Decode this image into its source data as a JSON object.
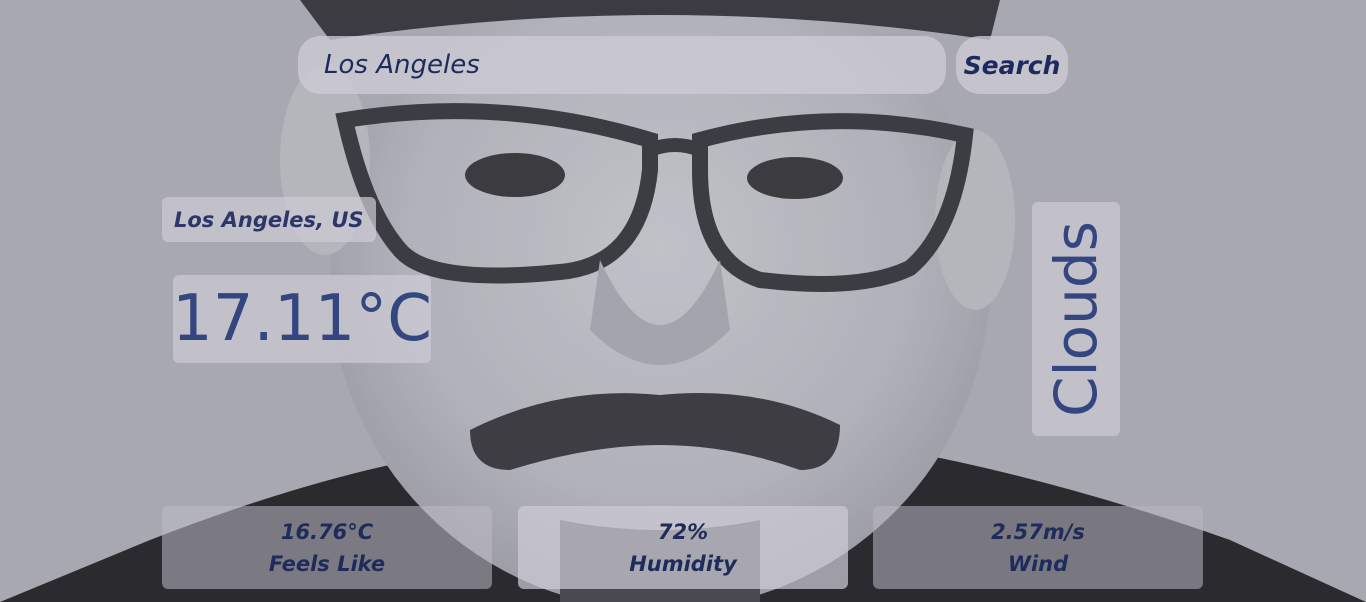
{
  "search": {
    "value": "Los Angeles",
    "button_label": "Search"
  },
  "weather": {
    "location": "Los Angeles, US",
    "temperature": "17.11°C",
    "condition": "Clouds"
  },
  "stats": {
    "feels_like_value": "16.76°C",
    "feels_like_label": "Feels Like",
    "humidity_value": "72%",
    "humidity_label": "Humidity",
    "wind_value": "2.57m/s",
    "wind_label": "Wind"
  },
  "colors": {
    "text_primary": "#1d2a5e",
    "text_accent": "#33467f",
    "panel": "#cdcbd4"
  }
}
